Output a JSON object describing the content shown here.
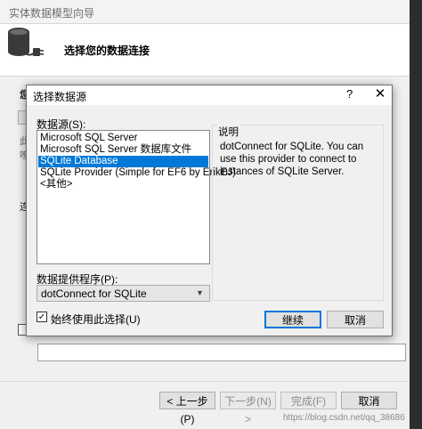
{
  "wizard": {
    "title": "实体数据模型向导",
    "header": "选择您的数据连接",
    "ghost_fragments": [
      "您",
      "此",
      "嘹",
      "连"
    ],
    "buttons": {
      "prev": "< 上一步(P)",
      "next": "下一步(N) >",
      "finish": "完成(F)",
      "cancel": "取消"
    },
    "watermark": "https://blog.csdn.net/qq_38686"
  },
  "dialog": {
    "title": "选择数据源",
    "help": "?",
    "close": "✕",
    "datasource_label": "数据源(S):",
    "datasources": [
      "Microsoft SQL Server",
      "Microsoft SQL Server 数据库文件",
      "SQLite Database",
      "SQLite Provider (Simple for EF6 by ErikEJ)",
      "<其他>"
    ],
    "selected_index": 2,
    "provider_label": "数据提供程序(P):",
    "provider_value": "dotConnect for SQLite",
    "always_use_label": "始终使用此选择(U)",
    "always_use_checked": true,
    "description_caption": "说明",
    "description": "dotConnect for SQLite. You can use this provider to connect to instances of SQLite Server.",
    "ok_label": "继续",
    "cancel_label": "取消"
  },
  "colors": {
    "selection": "#0078d7",
    "dialog_bg": "#f0f0f0",
    "dark_side": "#2d2d30"
  }
}
